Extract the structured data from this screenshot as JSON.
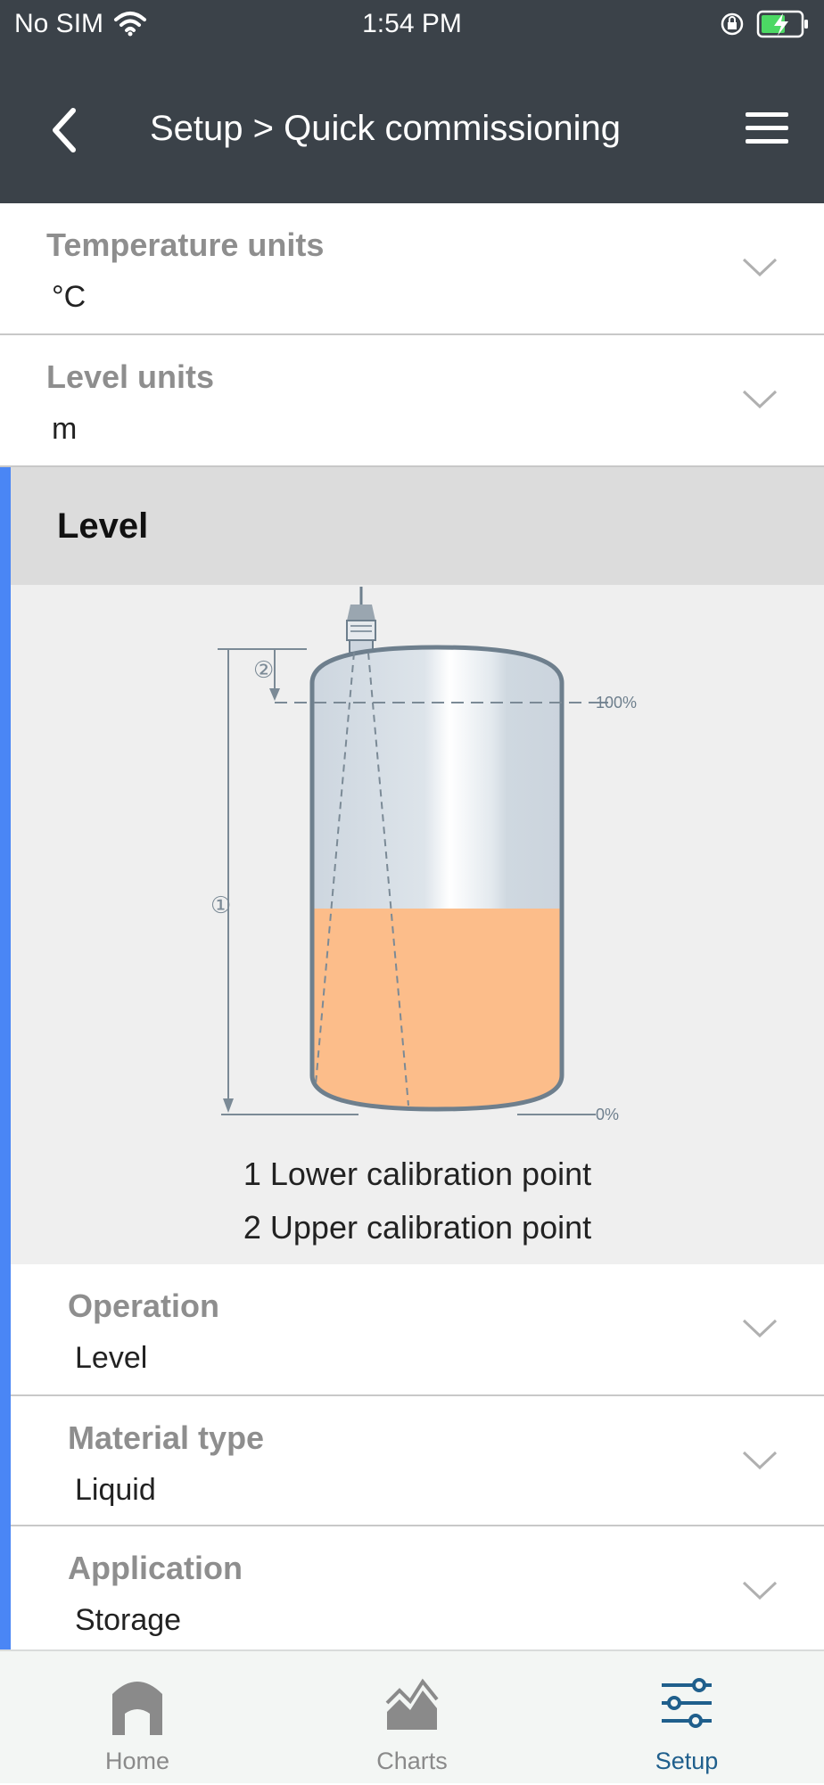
{
  "status_bar": {
    "carrier": "No SIM",
    "time": "1:54 PM",
    "icons": [
      "wifi-icon",
      "orientation-lock-icon",
      "battery-charging-icon"
    ]
  },
  "nav": {
    "title": "Setup > Quick commissioning",
    "back_icon": "chevron-left-icon",
    "menu_icon": "hamburger-menu-icon"
  },
  "rows_top": [
    {
      "label": "Temperature units",
      "value": "°C"
    },
    {
      "label": "Level units",
      "value": "m"
    }
  ],
  "level_section": {
    "title": "Level",
    "diagram": {
      "marker_1": "①",
      "marker_2": "②",
      "top_label": "100%",
      "bottom_label": "0%",
      "fill_fraction": 0.5
    },
    "legend": [
      "1 Lower calibration point",
      "2 Upper calibration point"
    ]
  },
  "rows_bottom": [
    {
      "label": "Operation",
      "value": "Level"
    },
    {
      "label": "Material type",
      "value": "Liquid"
    },
    {
      "label": "Application",
      "value": "Storage"
    }
  ],
  "tabs": [
    {
      "label": "Home",
      "icon": "home-icon",
      "active": false
    },
    {
      "label": "Charts",
      "icon": "chart-icon",
      "active": false
    },
    {
      "label": "Setup",
      "icon": "sliders-icon",
      "active": true
    }
  ],
  "colors": {
    "header_bg": "#3b4249",
    "accent": "#4a86f5",
    "liquid": "#fcbd8a",
    "active_tab": "#1f5f8c"
  }
}
